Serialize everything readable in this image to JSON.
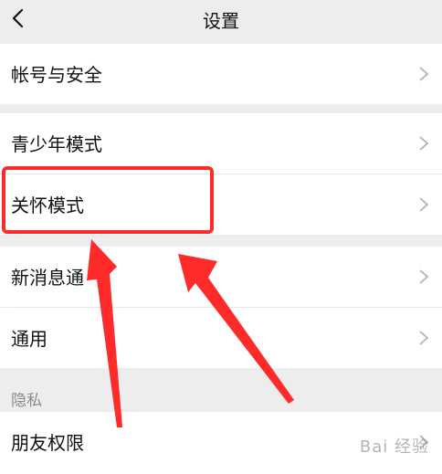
{
  "header": {
    "title": "设置"
  },
  "rows": [
    {
      "label": "帐号与安全"
    },
    {
      "label": "青少年模式"
    },
    {
      "label": "关怀模式"
    },
    {
      "label": "新消息通"
    },
    {
      "label": "通用"
    },
    {
      "label": "朋友权限"
    }
  ],
  "sections": {
    "privacy_label": "隐私"
  },
  "watermark": "Bai 经验",
  "annotation_color": "#ff2a2a"
}
